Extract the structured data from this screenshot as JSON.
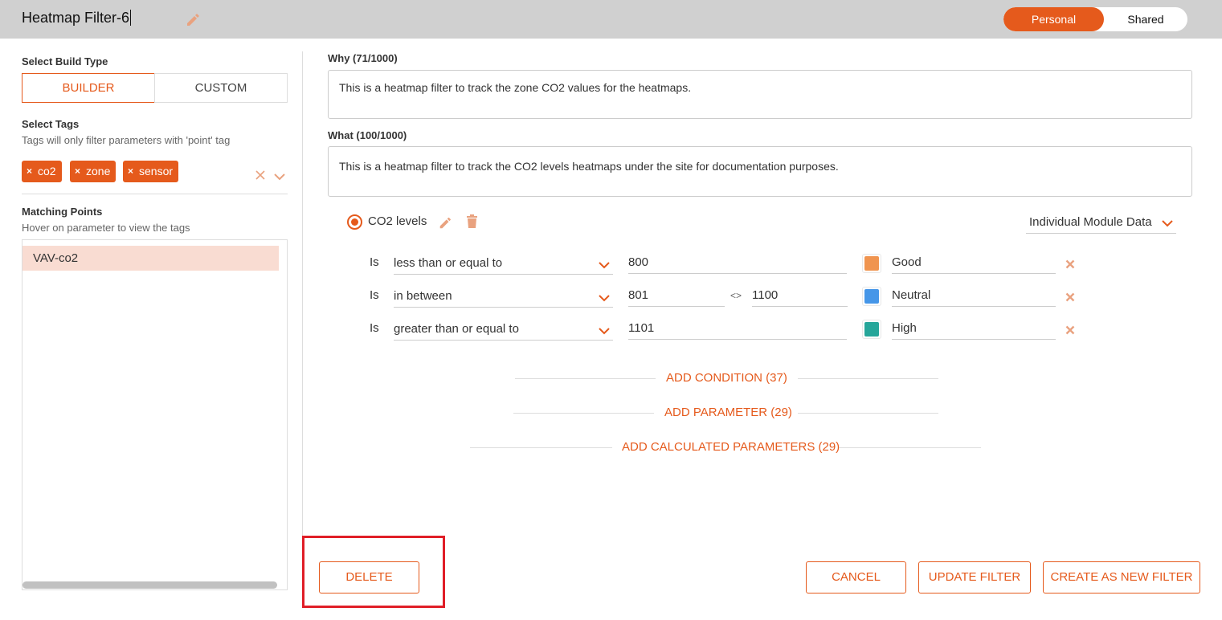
{
  "header": {
    "title": "Heatmap Filter-6",
    "toggle": {
      "personal": "Personal",
      "shared": "Shared",
      "active": "Personal"
    }
  },
  "left": {
    "build_type_label": "Select Build Type",
    "builder": "BUILDER",
    "custom": "CUSTOM",
    "tags_label": "Select Tags",
    "tags_hint": "Tags will only filter parameters with 'point' tag",
    "tags": [
      "co2",
      "zone",
      "sensor"
    ],
    "matching_label": "Matching Points",
    "matching_hint": "Hover on parameter to view the tags",
    "points": [
      "VAV-co2"
    ]
  },
  "right": {
    "why_label": "Why (71/1000)",
    "why_text": "This is a heatmap filter to track the zone CO2 values for the heatmaps.",
    "what_label": "What (100/1000)",
    "what_text": "This is a heatmap filter to track the CO2 levels heatmaps under the site for documentation purposes.",
    "param_name": "CO2 levels",
    "module_select": "Individual Module Data",
    "conditions": [
      {
        "is": "Is",
        "op": "less than or equal to",
        "v1": "800",
        "v2": "",
        "color": "#f0944f",
        "label": "Good"
      },
      {
        "is": "Is",
        "op": "in between",
        "v1": "801",
        "sep": "<>",
        "v2": "1100",
        "color": "#4596e8",
        "label": "Neutral"
      },
      {
        "is": "Is",
        "op": "greater than or equal to",
        "v1": "1101",
        "v2": "",
        "color": "#26a69a",
        "label": "High"
      }
    ],
    "add_condition": "ADD CONDITION (37)",
    "add_parameter": "ADD PARAMETER (29)",
    "add_calculated": "ADD CALCULATED PARAMETERS (29)"
  },
  "footer": {
    "delete": "DELETE",
    "cancel": "CANCEL",
    "update": "UPDATE FILTER",
    "create": "CREATE AS NEW FILTER"
  },
  "colors": {
    "accent": "#e55a1c",
    "highlight": "#e01e27"
  }
}
